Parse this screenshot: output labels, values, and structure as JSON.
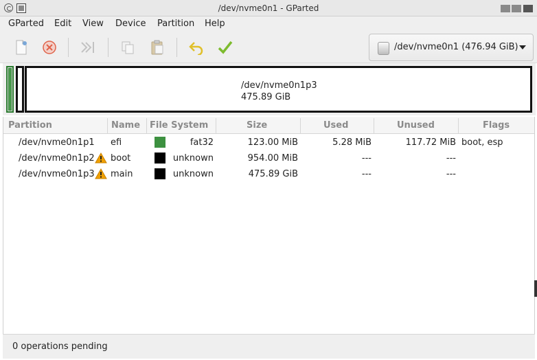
{
  "window": {
    "title": "/dev/nvme0n1 - GParted"
  },
  "menubar": {
    "items": [
      "GParted",
      "Edit",
      "View",
      "Device",
      "Partition",
      "Help"
    ]
  },
  "toolbar": {
    "buttons": [
      "new-icon",
      "delete-icon",
      "resize-move-icon",
      "copy-icon",
      "paste-icon",
      "undo-icon",
      "apply-icon"
    ]
  },
  "device_selector": {
    "label": "/dev/nvme0n1 (476.94 GiB)"
  },
  "disk_map": {
    "selected_partition": "/dev/nvme0n1p3",
    "selected_size": "475.89 GiB"
  },
  "partition_table": {
    "columns": [
      "Partition",
      "Name",
      "File System",
      "Size",
      "Used",
      "Unused",
      "Flags"
    ],
    "rows": [
      {
        "partition": "/dev/nvme0n1p1",
        "warning": false,
        "name": "efi",
        "fs_color": "#3d9140",
        "filesystem": "fat32",
        "size": "123.00 MiB",
        "used": "5.28 MiB",
        "unused": "117.72 MiB",
        "flags": "boot, esp"
      },
      {
        "partition": "/dev/nvme0n1p2",
        "warning": true,
        "name": "boot",
        "fs_color": "#000000",
        "filesystem": "unknown",
        "size": "954.00 MiB",
        "used": "---",
        "unused": "---",
        "flags": ""
      },
      {
        "partition": "/dev/nvme0n1p3",
        "warning": true,
        "name": "main",
        "fs_color": "#000000",
        "filesystem": "unknown",
        "size": "475.89 GiB",
        "used": "---",
        "unused": "---",
        "flags": ""
      }
    ]
  },
  "statusbar": {
    "text": "0 operations pending"
  },
  "colors": {
    "efi_green": "#3d9140",
    "warning": "#f0a000",
    "apply_green": "#7dbb2e",
    "undo_yellow": "#e0c02a",
    "delete_red": "#e0634a"
  }
}
